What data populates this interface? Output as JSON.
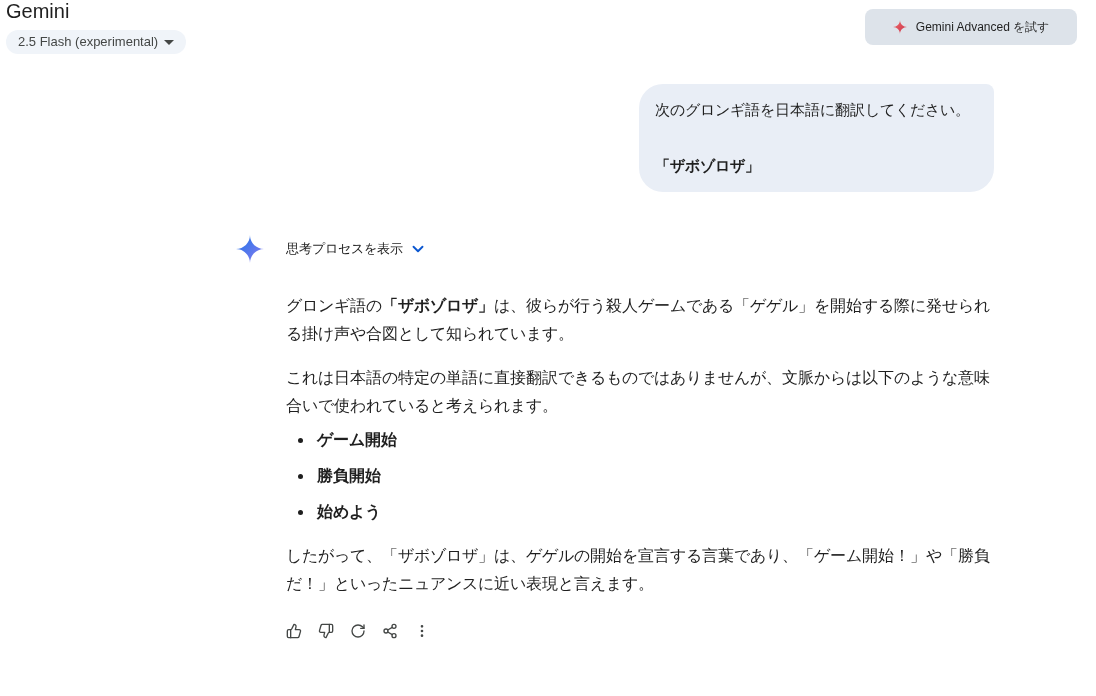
{
  "header": {
    "title": "Gemini",
    "model_selector": {
      "label": "2.5 Flash (experimental)"
    },
    "upgrade_button": {
      "label": "Gemini Advanced を試す"
    }
  },
  "conversation": {
    "user_message": {
      "paragraphs": [
        {
          "text": "次のグロンギ語を日本語に翻訳してください。",
          "bold": false
        },
        {
          "text": "「ザボゾロザ」",
          "bold": true
        }
      ]
    },
    "response": {
      "thoughts_toggle": {
        "label": "思考プロセスを表示",
        "expanded": false
      },
      "blocks": [
        {
          "kind": "paragraph",
          "text": "グロンギ語の**「ザボゾロザ」**は、彼らが行う殺人ゲームである「ゲゲル」を開始する際に発せられる掛け声や合図として知られています。"
        },
        {
          "kind": "paragraph",
          "text": "これは日本語の特定の単語に直接翻訳できるものではありませんが、文脈からは以下のような意味合いで使われていると考えられます。"
        },
        {
          "kind": "bullet_list",
          "items": [
            "ゲーム開始",
            "勝負開始",
            "始めよう"
          ]
        },
        {
          "kind": "paragraph",
          "text": "したがって、「ザボゾロザ」は、ゲゲルの開始を宣言する言葉であり、「ゲーム開始！」や「勝負だ！」といったニュアンスに近い表現と言えます。"
        }
      ]
    }
  }
}
